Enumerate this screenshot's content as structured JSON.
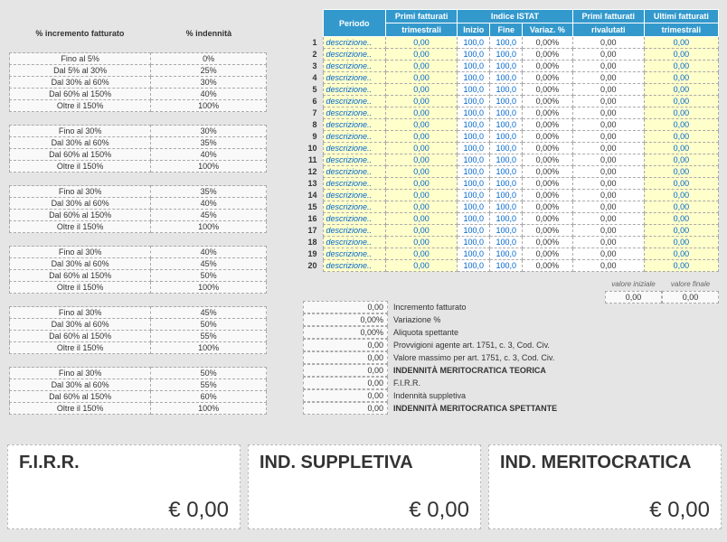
{
  "left_header": {
    "col1": "% incremento fatturato",
    "col2": "% indennità"
  },
  "left_tables": [
    {
      "rows": [
        [
          "Fino al 5%",
          "0%"
        ],
        [
          "Dal 5% al 30%",
          "25%"
        ],
        [
          "Dal 30% al 60%",
          "30%"
        ],
        [
          "Dal 60% al 150%",
          "40%"
        ],
        [
          "Oltre il 150%",
          "100%"
        ]
      ]
    },
    {
      "rows": [
        [
          "Fino al 30%",
          "30%"
        ],
        [
          "Dal 30% al 60%",
          "35%"
        ],
        [
          "Dal 60% al 150%",
          "40%"
        ],
        [
          "Oltre il 150%",
          "100%"
        ]
      ]
    },
    {
      "rows": [
        [
          "Fino al 30%",
          "35%"
        ],
        [
          "Dal 30% al 60%",
          "40%"
        ],
        [
          "Dal 60% al 150%",
          "45%"
        ],
        [
          "Oltre il 150%",
          "100%"
        ]
      ]
    },
    {
      "rows": [
        [
          "Fino al 30%",
          "40%"
        ],
        [
          "Dal 30% al 60%",
          "45%"
        ],
        [
          "Dal 60% al 150%",
          "50%"
        ],
        [
          "Oltre il 150%",
          "100%"
        ]
      ]
    },
    {
      "rows": [
        [
          "Fino al 30%",
          "45%"
        ],
        [
          "Dal 30% al 60%",
          "50%"
        ],
        [
          "Dal 60% al 150%",
          "55%"
        ],
        [
          "Oltre il 150%",
          "100%"
        ]
      ]
    },
    {
      "rows": [
        [
          "Fino al 30%",
          "50%"
        ],
        [
          "Dal 30% al 60%",
          "55%"
        ],
        [
          "Dal 60% al 150%",
          "60%"
        ],
        [
          "Oltre il 150%",
          "100%"
        ]
      ]
    }
  ],
  "main_headers": {
    "periodo": "Periodo",
    "primi_fatt": "Primi fatturati",
    "trimestrali": "trimestrali",
    "indice": "Indice ISTAT",
    "inizio": "Inizio",
    "fine": "Fine",
    "variaz": "Variaz. %",
    "rivalutati": "rivalutati",
    "ultimi_fatt": "Ultimi fatturati"
  },
  "main_rows": [
    {
      "n": "1",
      "d": "descrizione..",
      "v1": "0,00",
      "i": "100,0",
      "f": "100,0",
      "p": "0,00%",
      "r": "0,00",
      "u": "0,00"
    },
    {
      "n": "2",
      "d": "descrizione..",
      "v1": "0,00",
      "i": "100,0",
      "f": "100,0",
      "p": "0,00%",
      "r": "0,00",
      "u": "0,00"
    },
    {
      "n": "3",
      "d": "descrizione..",
      "v1": "0,00",
      "i": "100,0",
      "f": "100,0",
      "p": "0,00%",
      "r": "0,00",
      "u": "0,00"
    },
    {
      "n": "4",
      "d": "descrizione..",
      "v1": "0,00",
      "i": "100,0",
      "f": "100,0",
      "p": "0,00%",
      "r": "0,00",
      "u": "0,00"
    },
    {
      "n": "5",
      "d": "descrizione..",
      "v1": "0,00",
      "i": "100,0",
      "f": "100,0",
      "p": "0,00%",
      "r": "0,00",
      "u": "0,00"
    },
    {
      "n": "6",
      "d": "descrizione..",
      "v1": "0,00",
      "i": "100,0",
      "f": "100,0",
      "p": "0,00%",
      "r": "0,00",
      "u": "0,00"
    },
    {
      "n": "7",
      "d": "descrizione..",
      "v1": "0,00",
      "i": "100,0",
      "f": "100,0",
      "p": "0,00%",
      "r": "0,00",
      "u": "0,00"
    },
    {
      "n": "8",
      "d": "descrizione..",
      "v1": "0,00",
      "i": "100,0",
      "f": "100,0",
      "p": "0,00%",
      "r": "0,00",
      "u": "0,00"
    },
    {
      "n": "9",
      "d": "descrizione..",
      "v1": "0,00",
      "i": "100,0",
      "f": "100,0",
      "p": "0,00%",
      "r": "0,00",
      "u": "0,00"
    },
    {
      "n": "10",
      "d": "descrizione..",
      "v1": "0,00",
      "i": "100,0",
      "f": "100,0",
      "p": "0,00%",
      "r": "0,00",
      "u": "0,00"
    },
    {
      "n": "11",
      "d": "descrizione..",
      "v1": "0,00",
      "i": "100,0",
      "f": "100,0",
      "p": "0,00%",
      "r": "0,00",
      "u": "0,00"
    },
    {
      "n": "12",
      "d": "descrizione..",
      "v1": "0,00",
      "i": "100,0",
      "f": "100,0",
      "p": "0,00%",
      "r": "0,00",
      "u": "0,00"
    },
    {
      "n": "13",
      "d": "descrizione..",
      "v1": "0,00",
      "i": "100,0",
      "f": "100,0",
      "p": "0,00%",
      "r": "0,00",
      "u": "0,00"
    },
    {
      "n": "14",
      "d": "descrizione..",
      "v1": "0,00",
      "i": "100,0",
      "f": "100,0",
      "p": "0,00%",
      "r": "0,00",
      "u": "0,00"
    },
    {
      "n": "15",
      "d": "descrizione..",
      "v1": "0,00",
      "i": "100,0",
      "f": "100,0",
      "p": "0,00%",
      "r": "0,00",
      "u": "0,00"
    },
    {
      "n": "16",
      "d": "descrizione..",
      "v1": "0,00",
      "i": "100,0",
      "f": "100,0",
      "p": "0,00%",
      "r": "0,00",
      "u": "0,00"
    },
    {
      "n": "17",
      "d": "descrizione..",
      "v1": "0,00",
      "i": "100,0",
      "f": "100,0",
      "p": "0,00%",
      "r": "0,00",
      "u": "0,00"
    },
    {
      "n": "18",
      "d": "descrizione..",
      "v1": "0,00",
      "i": "100,0",
      "f": "100,0",
      "p": "0,00%",
      "r": "0,00",
      "u": "0,00"
    },
    {
      "n": "19",
      "d": "descrizione..",
      "v1": "0,00",
      "i": "100,0",
      "f": "100,0",
      "p": "0,00%",
      "r": "0,00",
      "u": "0,00"
    },
    {
      "n": "20",
      "d": "descrizione..",
      "v1": "0,00",
      "i": "100,0",
      "f": "100,0",
      "p": "0,00%",
      "r": "0,00",
      "u": "0,00"
    }
  ],
  "valore": {
    "iniziale_lbl": "valore iniziale",
    "finale_lbl": "valore finale",
    "iniziale": "0,00",
    "finale": "0,00"
  },
  "summary": [
    {
      "v": "0,00",
      "l": "Incremento fatturato",
      "b": false
    },
    {
      "v": "0,00%",
      "l": "Variazione %",
      "b": false
    },
    {
      "v": "0,00%",
      "l": "Aliquota spettante",
      "b": false
    },
    {
      "v": "0,00",
      "l": "Provvigioni agente art. 1751, c. 3, Cod. Civ.",
      "b": false
    },
    {
      "v": "0,00",
      "l": "Valore massimo per art. 1751, c. 3, Cod. Civ.",
      "b": false
    },
    {
      "v": "0,00",
      "l": "INDENNITÀ MERITOCRATICA TEORICA",
      "b": true
    },
    {
      "v": "0,00",
      "l": "F.I.R.R.",
      "b": false
    },
    {
      "v": "0,00",
      "l": "Indennità suppletiva",
      "b": false
    },
    {
      "v": "0,00",
      "l": "INDENNITÀ MERITOCRATICA SPETTANTE",
      "b": true
    }
  ],
  "cards": {
    "firr": {
      "title": "F.I.R.R.",
      "value": "€ 0,00"
    },
    "suppletiva": {
      "title": "IND. SUPPLETIVA",
      "value": "€ 0,00"
    },
    "meritocratica": {
      "title": "IND. MERITOCRATICA",
      "value": "€ 0,00"
    }
  }
}
